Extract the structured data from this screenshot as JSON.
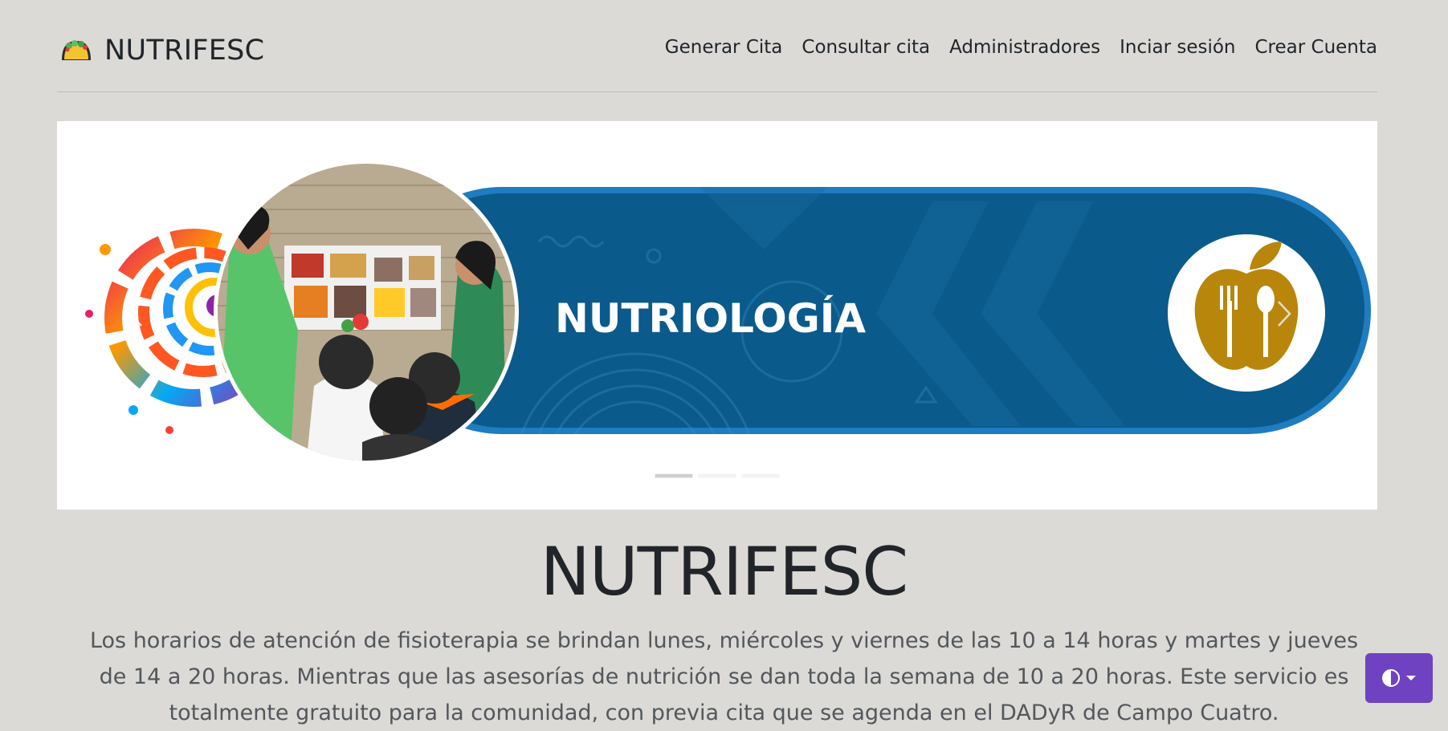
{
  "brand": {
    "name": "NUTRIFESC",
    "logo_icon": "taco-icon"
  },
  "nav": [
    {
      "label": "Generar Cita"
    },
    {
      "label": "Consultar cita"
    },
    {
      "label": "Administradores"
    },
    {
      "label": "Inciar sesión"
    },
    {
      "label": "Crear Cuenta"
    }
  ],
  "carousel": {
    "banner_text": "NUTRIOLOGÍA",
    "slide_count": 3,
    "active_slide": 1,
    "prev_icon": "chevron-left-icon",
    "next_icon": "chevron-right-icon",
    "banner_emblem": "apple-fork-spoon-icon"
  },
  "hero": {
    "title": "NUTRIFESC",
    "description": "Los horarios de atención de fisioterapia se brindan lunes, miércoles y viernes de las 10 a 14 horas y martes y jueves de 14 a 20 horas. Mientras que las asesorías de nutrición se dan toda la semana de 10 a 20 horas. Este servicio es totalmente gratuito para la comunidad, con previa cita que se agenda en el DADyR de Campo Cuatro."
  },
  "theme_toggle": {
    "icon": "contrast-icon",
    "caret_icon": "caret-down-icon"
  },
  "colors": {
    "background": "#dbdad6",
    "banner_blue": "#0b5a8c",
    "accent_purple": "#6f42c1",
    "emblem_gold": "#b8860b"
  }
}
